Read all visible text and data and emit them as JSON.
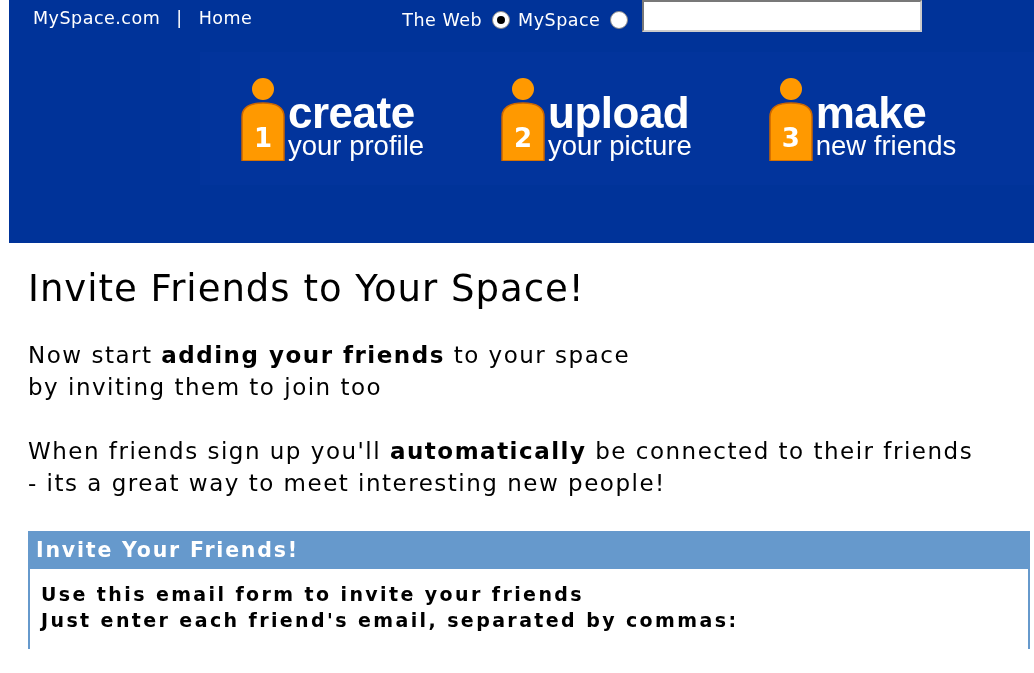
{
  "top_bar": {
    "links": [
      {
        "label": "MySpace.com"
      },
      {
        "label": "Home"
      }
    ],
    "separator": "|",
    "search_options": [
      {
        "label": "The Web",
        "selected": true
      },
      {
        "label": "MySpace",
        "selected": false
      }
    ]
  },
  "steps": [
    {
      "number": "1",
      "title": "create",
      "subtitle": "your profile"
    },
    {
      "number": "2",
      "title": "upload",
      "subtitle": "your picture"
    },
    {
      "number": "3",
      "title": "make",
      "subtitle": "new friends"
    }
  ],
  "heading": "Invite Friends to Your Space!",
  "paragraphs": [
    {
      "lines": [
        "Now start **adding your friends** to your space",
        "by inviting them to join too"
      ]
    },
    {
      "lines": [
        "When friends sign up you'll **automatically** be connected to their friends",
        "- its a great way to meet interesting new people!"
      ]
    }
  ],
  "invite_box": {
    "title": "Invite Your Friends!",
    "lines": [
      "Use this email form to invite your friends",
      "Just enter each friend's email, separated by commas:"
    ]
  }
}
